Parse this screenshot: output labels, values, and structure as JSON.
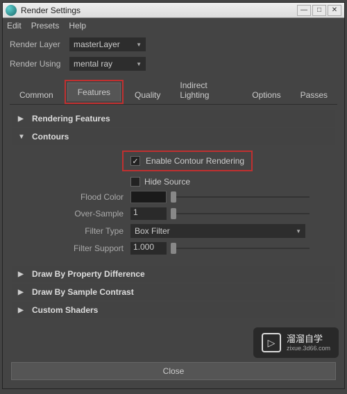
{
  "window": {
    "title": "Render Settings"
  },
  "menubar": [
    "Edit",
    "Presets",
    "Help"
  ],
  "renderLayer": {
    "label": "Render Layer",
    "value": "masterLayer"
  },
  "renderUsing": {
    "label": "Render Using",
    "value": "mental ray"
  },
  "tabs": {
    "items": [
      "Common",
      "Features",
      "Quality",
      "Indirect Lighting",
      "Options",
      "Passes"
    ],
    "active": "Features"
  },
  "sections": {
    "renderingFeatures": {
      "label": "Rendering Features",
      "expanded": false
    },
    "contours": {
      "label": "Contours",
      "expanded": true,
      "enable": {
        "label": "Enable Contour Rendering",
        "checked": true
      },
      "hideSource": {
        "label": "Hide Source",
        "checked": false
      },
      "floodColor": {
        "label": "Flood Color"
      },
      "overSample": {
        "label": "Over-Sample",
        "value": "1"
      },
      "filterType": {
        "label": "Filter Type",
        "value": "Box Filter"
      },
      "filterSupport": {
        "label": "Filter Support",
        "value": "1.000"
      }
    },
    "drawByProp": {
      "label": "Draw By Property Difference",
      "expanded": false
    },
    "drawBySample": {
      "label": "Draw By Sample Contrast",
      "expanded": false
    },
    "customShaders": {
      "label": "Custom Shaders",
      "expanded": false
    }
  },
  "closeButton": "Close",
  "watermark": {
    "text": "溜溜自学",
    "sub": "zixue.3d66.com"
  }
}
